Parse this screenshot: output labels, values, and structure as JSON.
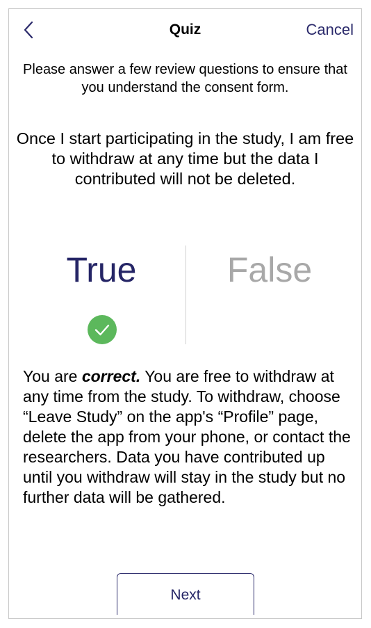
{
  "nav": {
    "title": "Quiz",
    "cancel_label": "Cancel",
    "back_icon": "chevron-left-icon"
  },
  "intro": "Please answer a few review questions to ensure that you understand the consent form.",
  "question": "Once I start participating in the study, I am free to withdraw at any time but the data I contributed will not be deleted.",
  "answers": {
    "true_label": "True",
    "false_label": "False",
    "selected": "True",
    "selected_icon": "check-circle-icon"
  },
  "explanation": {
    "prefix": "You are ",
    "emphasis": "correct.",
    "body": " You are free to withdraw at any time from the study. To withdraw, choose “Leave Study” on the app's “Profile” page, delete the app from your phone, or contact the researchers. Data you have contributed up until you withdraw will stay in the study but no further data will be gathered."
  },
  "next_label": "Next",
  "colors": {
    "accent": "#252566",
    "inactive": "#a8a8a8",
    "success": "#5cb85c",
    "divider": "#d0d0d0"
  }
}
